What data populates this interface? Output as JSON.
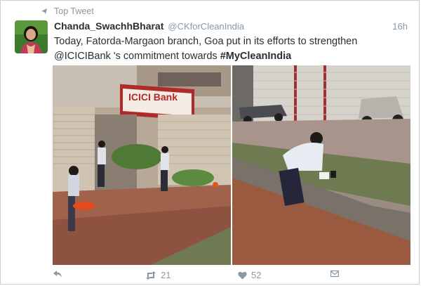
{
  "header": {
    "context_label": "Top Tweet"
  },
  "tweet": {
    "display_name": "Chanda_SwachhBharat",
    "handle": "@CKforCleanIndia",
    "time": "16h",
    "text_part1": "Today, Fatorda-Margaon branch, Goa put in its efforts to strengthen",
    "mention": "@ICICIBank",
    "text_part2": " 's commitment towards ",
    "hashtag": "#MyCleanIndia",
    "sign_text": "ICICI Bank"
  },
  "actions": {
    "retweet_count": "21",
    "like_count": "52"
  },
  "colors": {
    "secondary_text": "#8899a6",
    "primary_text": "#292f33",
    "icici_red": "#b02a2a"
  },
  "icons": {
    "context": "pin-icon",
    "reply": "reply-icon",
    "retweet": "retweet-icon",
    "like": "heart-icon",
    "dm": "envelope-icon"
  }
}
